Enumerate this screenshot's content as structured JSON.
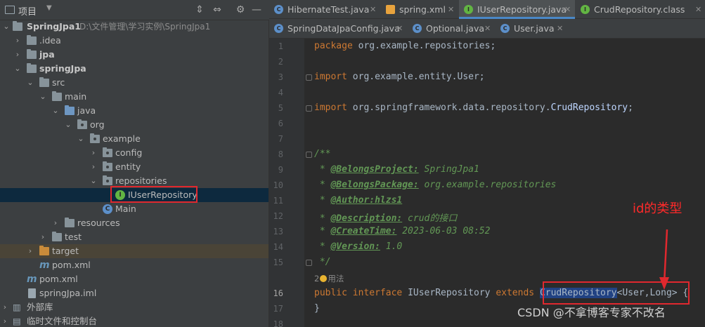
{
  "project_panel": {
    "title": "项目",
    "tree": [
      {
        "label": "SpringJpa1",
        "detail": "D:\\文件管理\\学习实例\\SpringJpa1"
      },
      {
        "label": ".idea"
      },
      {
        "label": "jpa"
      },
      {
        "label": "springJpa"
      },
      {
        "label": "src"
      },
      {
        "label": "main"
      },
      {
        "label": "java"
      },
      {
        "label": "org"
      },
      {
        "label": "example"
      },
      {
        "label": "config"
      },
      {
        "label": "entity"
      },
      {
        "label": "repositories"
      },
      {
        "label": "IUserRepository"
      },
      {
        "label": "Main"
      },
      {
        "label": "resources"
      },
      {
        "label": "test"
      },
      {
        "label": "target"
      },
      {
        "label": "pom.xml"
      },
      {
        "label": "pom.xml"
      },
      {
        "label": "springJpa.iml"
      },
      {
        "label": "外部库"
      },
      {
        "label": "临时文件和控制台"
      }
    ]
  },
  "tabs_row1": [
    {
      "label": "HibernateTest.java"
    },
    {
      "label": "spring.xml"
    },
    {
      "label": "IUserRepository.java"
    },
    {
      "label": "CrudRepository.class"
    }
  ],
  "tabs_row2": [
    {
      "label": "SpringDataJpaConfig.java"
    },
    {
      "label": "Optional.java"
    },
    {
      "label": "User.java"
    }
  ],
  "editor": {
    "line_numbers": [
      "1",
      "2",
      "3",
      "4",
      "5",
      "6",
      "7",
      "8",
      "9",
      "10",
      "11",
      "12",
      "13",
      "14",
      "15",
      "16",
      "17",
      "18"
    ],
    "line1": {
      "kw": "package",
      "rest": " org.example.repositories;"
    },
    "line3": {
      "kw": "import",
      "rest": " org.example.entity.User;"
    },
    "line5": {
      "kw": "import",
      "rest": " org.springframework.data.repository.",
      "iface": "CrudRepository",
      "end": ";"
    },
    "line8": "/**",
    "doc_lines": [
      {
        "tag": "@BelongsProject:",
        "value": " SpringJpa1"
      },
      {
        "tag": "@BelongsPackage:",
        "value": " org.example.repositories"
      },
      {
        "tag": "@Author:hlzs1",
        "value": ""
      },
      {
        "tag": "@Description:",
        "value": " crud的接口"
      },
      {
        "tag": "@CreateTime:",
        "value": " 2023-06-03 08:52"
      },
      {
        "tag": "@Version:",
        "value": " 1.0"
      }
    ],
    "doc_end": " */",
    "usages_count": "2",
    "usages_label": "用法",
    "line16": {
      "kw1": "public",
      "kw2": "interface",
      "name": "IUserRepository",
      "kw3": "extends",
      "selected": "CrudRepository",
      "generic": "<User,Long>",
      "end": " {"
    },
    "line17": "}"
  },
  "annotation": "id的类型",
  "watermark": "CSDN @不拿博客专家不改名",
  "colors": {
    "annotation_red": "#e0282e",
    "selection_blue": "#214283",
    "keyword": "#cc7832",
    "doc": "#629755"
  }
}
